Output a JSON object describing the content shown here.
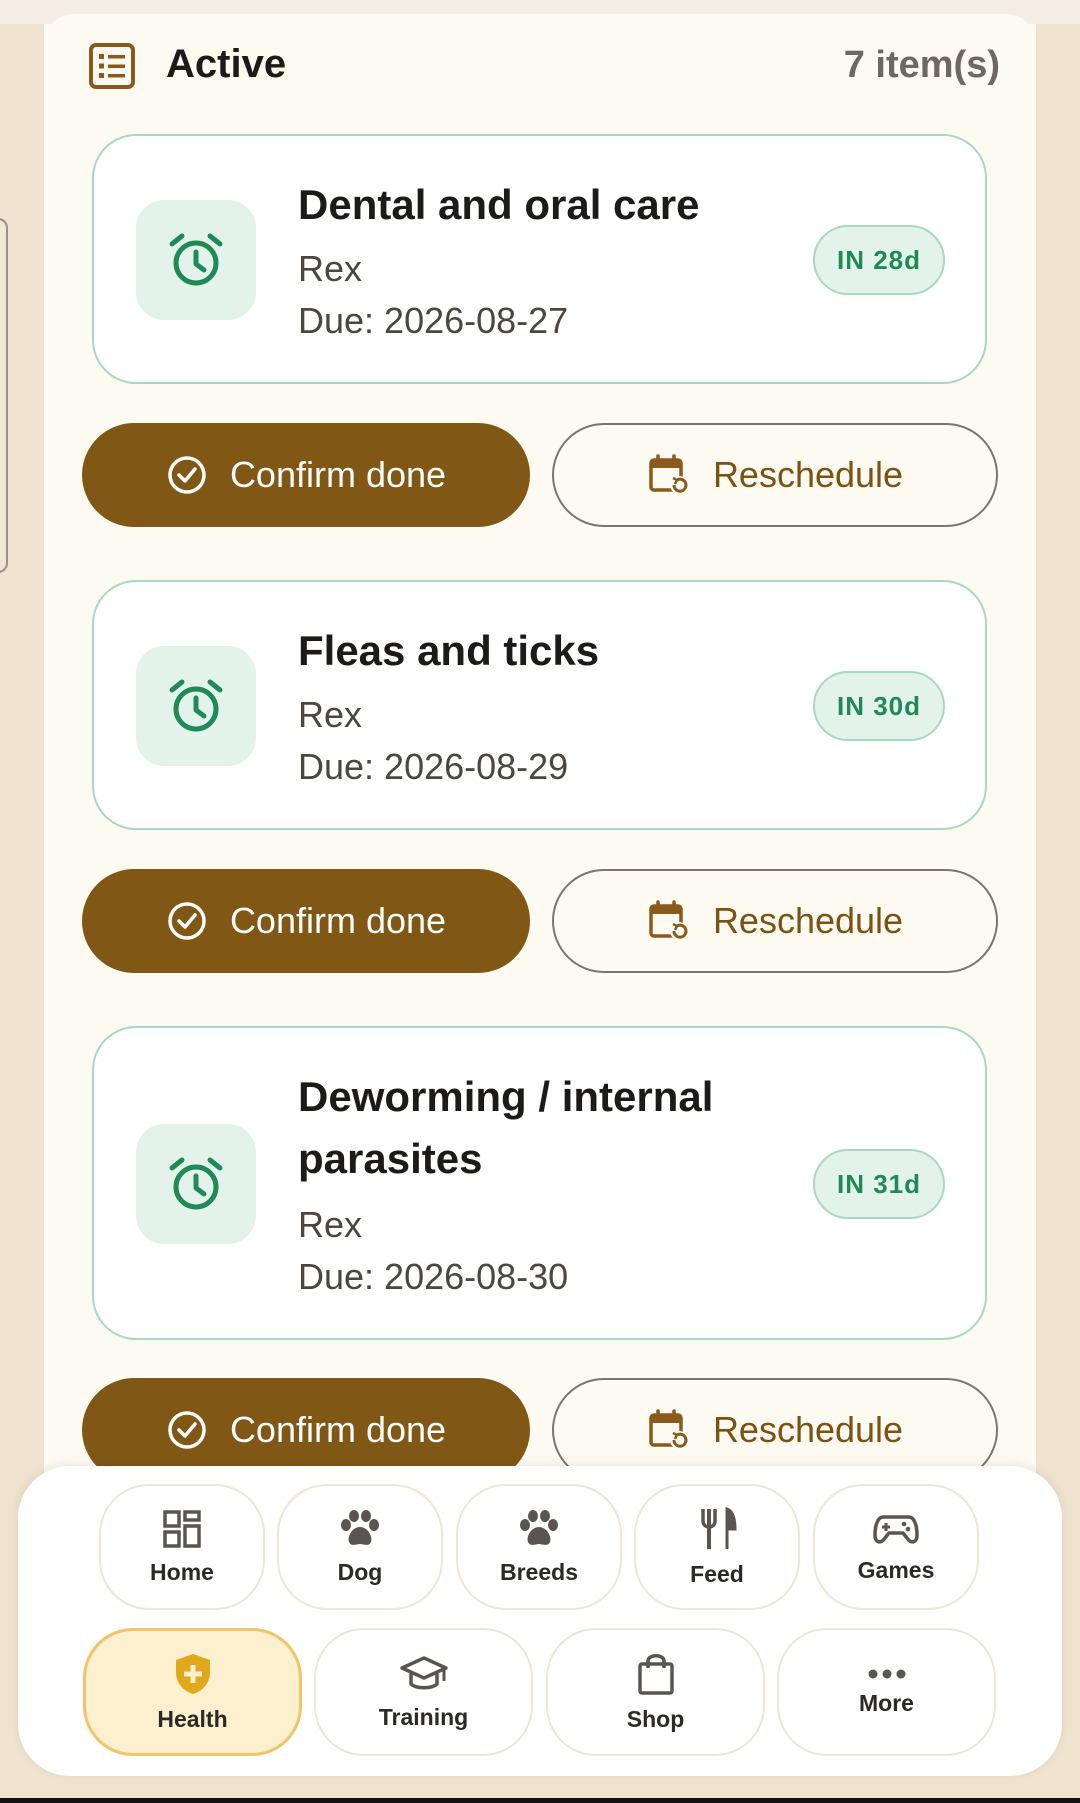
{
  "section": {
    "title": "Active",
    "count": "7 item(s)",
    "icon": "list-icon"
  },
  "reminders": [
    {
      "title_lines": [
        "Dental and oral care"
      ],
      "pet": "Rex",
      "due": "Due: 2026-08-27",
      "badge": "IN 28d",
      "icon": "alarm-clock-icon"
    },
    {
      "title_lines": [
        "Fleas and ticks"
      ],
      "pet": "Rex",
      "due": "Due: 2026-08-29",
      "badge": "IN 30d",
      "icon": "alarm-clock-icon"
    },
    {
      "title_lines": [
        "Deworming / internal",
        "parasites"
      ],
      "pet": "Rex",
      "due": "Due: 2026-08-30",
      "badge": "IN 31d",
      "icon": "alarm-clock-icon"
    }
  ],
  "actions": {
    "confirm_label": "Confirm done",
    "reschedule_label": "Reschedule"
  },
  "nav": {
    "row1": [
      {
        "label": "Home",
        "icon": "dashboard-icon"
      },
      {
        "label": "Dog",
        "icon": "paw-icon"
      },
      {
        "label": "Breeds",
        "icon": "paw-icon"
      },
      {
        "label": "Feed",
        "icon": "fork-knife-icon"
      },
      {
        "label": "Games",
        "icon": "gamepad-icon"
      }
    ],
    "row2": [
      {
        "label": "Health",
        "icon": "health-shield-icon",
        "active": true
      },
      {
        "label": "Training",
        "icon": "graduation-cap-icon"
      },
      {
        "label": "Shop",
        "icon": "shopping-bag-icon"
      },
      {
        "label": "More",
        "icon": "more-dots-icon"
      }
    ]
  },
  "colors": {
    "primary_brown": "#815716",
    "accent_green": "#1f8a55",
    "badge_bg": "#e3f3ec",
    "active_nav_bg": "#fdf0cf"
  }
}
